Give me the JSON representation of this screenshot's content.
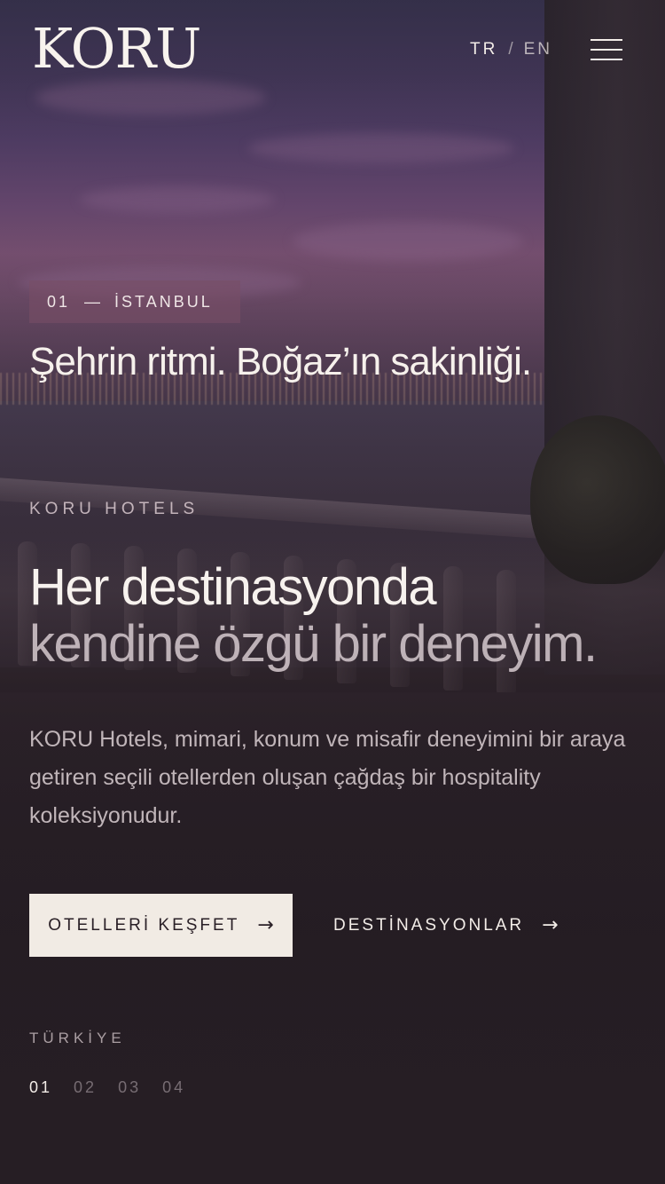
{
  "header": {
    "logo": "KORU",
    "lang_current": "TR",
    "lang_separator": "/",
    "lang_other": "EN",
    "menu_icon": "hamburger-menu-icon"
  },
  "slide": {
    "index": "01",
    "dash": "—",
    "city": "İSTANBUL",
    "title": "Şehrin ritmi. Boğaz’ın sakinliği."
  },
  "brand": {
    "eyebrow": "KORU HOTELS",
    "headline_line1": "Her destinasyonda",
    "headline_line2": "kendine özgü bir deneyim.",
    "lead": "KORU Hotels, mimari, konum ve misafir deneyimini bir araya getiren seçili otellerden oluşan çağdaş bir hospitality koleksiyonudur."
  },
  "cta": {
    "primary_label": "OTELLERİ KEŞFET",
    "secondary_label": "DESTİNASYONLAR",
    "arrow": "→",
    "primary_bg": "#f1ebe4",
    "primary_text": "#2a2027"
  },
  "pager": {
    "country": "TÜRKİYE",
    "items": [
      "01",
      "02",
      "03",
      "04"
    ],
    "active_index": 0
  },
  "colors": {
    "tag_bg": "#7a4e66",
    "text_light": "#f3ede8"
  }
}
